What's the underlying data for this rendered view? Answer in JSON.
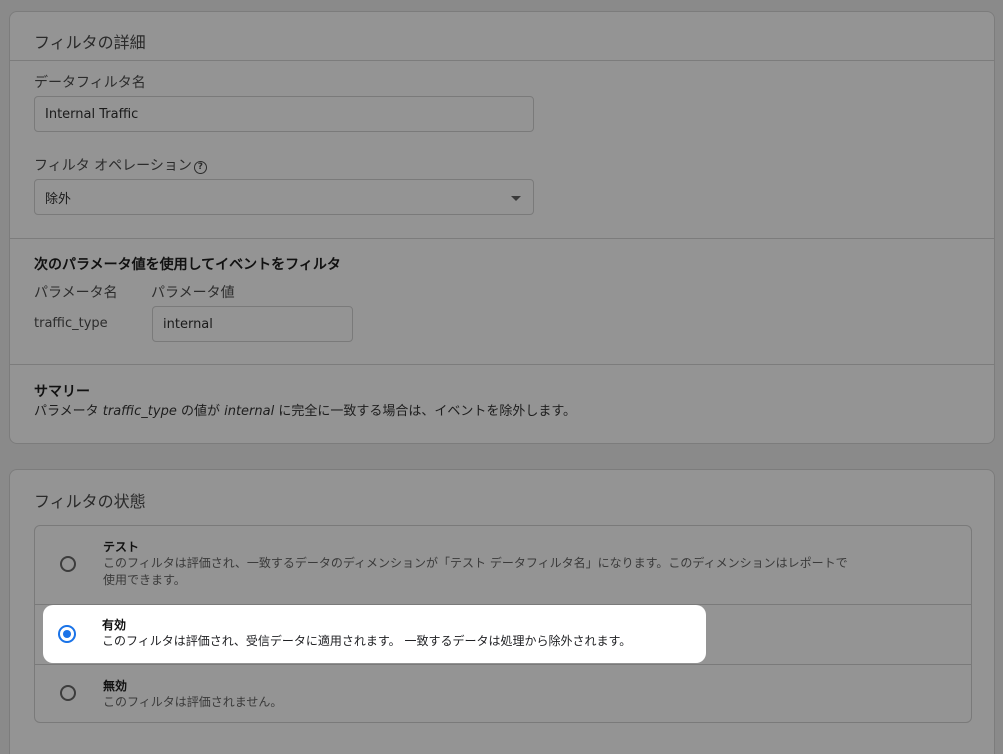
{
  "details": {
    "title": "フィルタの詳細",
    "name_label": "データフィルタ名",
    "name_value": "Internal Traffic",
    "operation_label": "フィルタ オペレーション",
    "operation_value": "除外",
    "params_heading": "次のパラメータ値を使用してイベントをフィルタ",
    "param_name_header": "パラメータ名",
    "param_value_header": "パラメータ値",
    "param_name": "traffic_type",
    "param_value": "internal",
    "summary_heading": "サマリー",
    "summary_prefix": "パラメータ ",
    "summary_param": "traffic_type",
    "summary_mid": " の値が ",
    "summary_value": "internal",
    "summary_suffix": " に完全に一致する場合は、イベントを除外します。"
  },
  "state": {
    "title": "フィルタの状態",
    "selected": "有効",
    "options": [
      {
        "title": "テスト",
        "desc_line1": "このフィルタは評価され、一致するデータのディメンションが「テスト データフィルタ名」になります。このディメンションはレポートで",
        "desc_line2": "使用できます。"
      },
      {
        "title": "有効",
        "desc_line1": "このフィルタは評価され、受信データに適用されます。 一致するデータは処理から除外されます。"
      },
      {
        "title": "無効",
        "desc_line1": "このフィルタは評価されません。"
      }
    ]
  },
  "colors": {
    "accent": "#1a73e8",
    "overlay": "#8a8a8a"
  }
}
